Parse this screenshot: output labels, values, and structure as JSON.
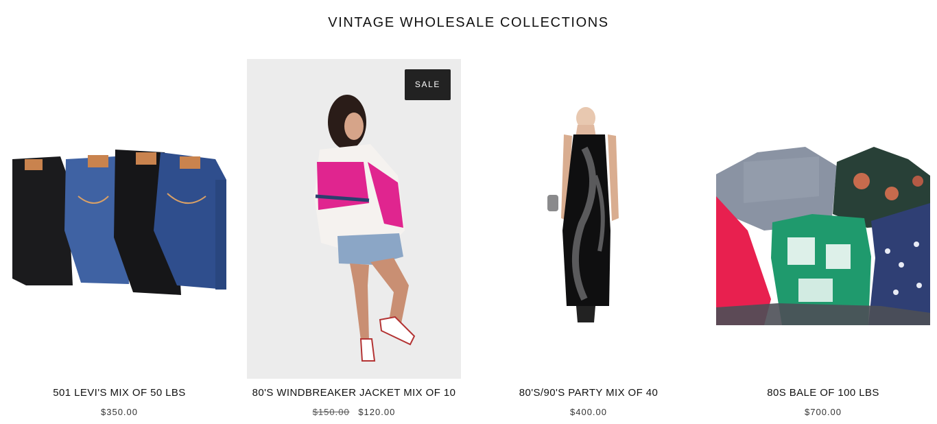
{
  "section": {
    "title": "VINTAGE WHOLESALE COLLECTIONS"
  },
  "products": [
    {
      "name": "501 LEVI'S MIX OF 50 LBS",
      "price": "$350.00",
      "image_icon": "jeans-stack-image"
    },
    {
      "name": "80'S WINDBREAKER JACKET MIX OF 10",
      "price_original": "$150.00",
      "price": "$120.00",
      "badge": "SALE",
      "image_icon": "model-jacket-image"
    },
    {
      "name": "80'S/90'S PARTY MIX OF 40",
      "price": "$400.00",
      "image_icon": "black-dress-image"
    },
    {
      "name": "80S BALE OF 100 LBS",
      "price": "$700.00",
      "image_icon": "clothing-pile-image"
    }
  ],
  "colors": {
    "badge_bg": "#222222",
    "text": "#111111",
    "price": "#333333"
  }
}
